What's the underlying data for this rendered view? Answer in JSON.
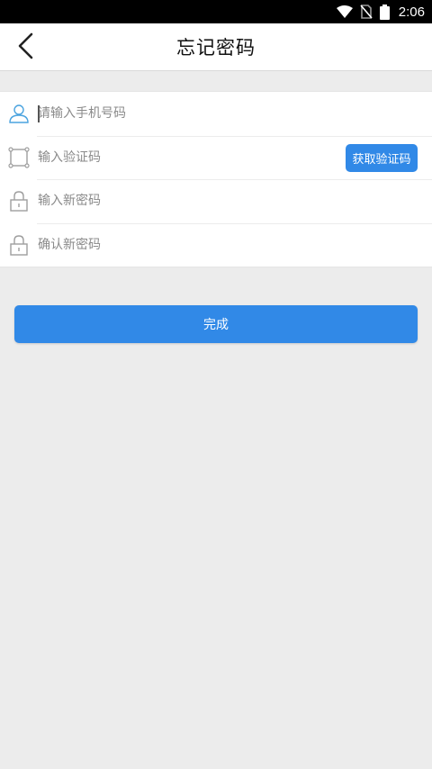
{
  "status_bar": {
    "time": "2:06",
    "icons": [
      "wifi-icon",
      "no-sim-icon",
      "battery-icon"
    ]
  },
  "app_bar": {
    "title": "忘记密码",
    "back_icon": "chevron-left-icon"
  },
  "form": {
    "phone": {
      "icon": "user-icon",
      "placeholder": "请输入手机号码",
      "value": ""
    },
    "code": {
      "icon": "frame-icon",
      "placeholder": "输入验证码",
      "value": "",
      "button_label": "获取验证码"
    },
    "new_password": {
      "icon": "lock-icon",
      "placeholder": "输入新密码",
      "value": ""
    },
    "confirm_password": {
      "icon": "lock-icon",
      "placeholder": "确认新密码",
      "value": ""
    }
  },
  "actions": {
    "submit_label": "完成"
  },
  "colors": {
    "accent": "#3189e7",
    "background": "#ececec",
    "active_icon": "#4aa3df",
    "inactive_icon": "#9e9e9e"
  }
}
